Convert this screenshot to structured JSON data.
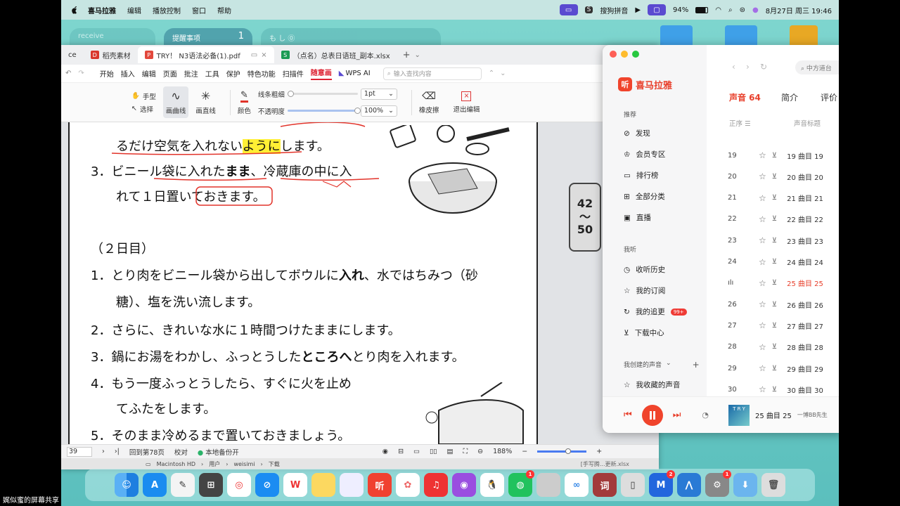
{
  "menubar": {
    "app": "喜马拉雅",
    "items": [
      "编辑",
      "播放控制",
      "窗口",
      "帮助"
    ],
    "pinyin": "搜狗拼音",
    "battery": "94%",
    "datetime": "8月27日 周三  19:46"
  },
  "widgets": {
    "receive": "receive",
    "reminder": "提醒事项",
    "reminder_count": "1",
    "note": "も し ⓪"
  },
  "wps": {
    "tabs": [
      {
        "label": "ce",
        "active": false
      },
      {
        "label": "稻壳素材",
        "active": false,
        "badge": "D",
        "color": "#d9372c"
      },
      {
        "label": "TRY！ N3语法必备(1).pdf",
        "active": true,
        "badge": "P",
        "color": "#e2483c"
      },
      {
        "label": "（点名）总表日语班_副本.xlsx",
        "active": false,
        "badge": "S",
        "color": "#1c9b54"
      }
    ],
    "menus": [
      "开始",
      "插入",
      "编辑",
      "页面",
      "批注",
      "工具",
      "保护",
      "特色功能",
      "扫描件",
      "随意画",
      "WPS AI"
    ],
    "menu_selected": "随意画",
    "search_placeholder": "输入查找内容",
    "toolbar": {
      "hand": "手型",
      "select": "选择",
      "curve": "画曲线",
      "straight": "画直线",
      "color": "颜色",
      "line_width": "线条粗细",
      "line_width_value": "1pt",
      "opacity": "不透明度",
      "opacity_value": "100%",
      "eraser": "橡皮擦",
      "exit": "退出编辑"
    },
    "status": {
      "page_input": "39",
      "goto": "回到第78页",
      "proof": "校对",
      "backup": "本地备份开",
      "zoom": "188%"
    },
    "path": [
      "Macintosh HD",
      "用户",
      "weisimi",
      "下载"
    ],
    "path_file": "[手写腾...更新.xlsx"
  },
  "document": {
    "line1": {
      "pre": "るだけ空気を入れない",
      "highlight": "ように",
      "post": "します。"
    },
    "line2": {
      "num": "3．",
      "a": "ビニール袋に入れた",
      "b": "まま",
      "c": "、冷蔵庫の中に入"
    },
    "line3": "れて１日置いておきます。",
    "heading": "（２日目）",
    "l1": {
      "num": "1．",
      "a": "とり肉をビニール袋から出してボウルに",
      "b": "入れ",
      "c": "、水ではちみつ（砂"
    },
    "l1b": "糖）、塩を洗い流します。",
    "l2": {
      "num": "2．",
      "text": "さらに、きれいな水に１時間つけたままにします。"
    },
    "l3": {
      "num": "3．",
      "a": "鍋にお湯をわかし、ふっとうした",
      "b": "ところへ",
      "c": "とり肉を入れます。"
    },
    "l4": {
      "num": "4．",
      "text": "もう一度ふっとうしたら、すぐに火を止め"
    },
    "l4b": "てふたをします。",
    "l5": {
      "num": "5．",
      "text": "そのまま冷めるまで置いておきましょう。"
    },
    "side": [
      "42",
      "〜",
      "50"
    ]
  },
  "music": {
    "brand": "喜马拉雅",
    "section_recommend": "推荐",
    "nav": [
      "发现",
      "会员专区",
      "排行榜",
      "全部分类",
      "直播"
    ],
    "section_mine": "我听",
    "nav2": [
      "收听历史",
      "我的订阅",
      "我的追更",
      "下载中心"
    ],
    "badge": "99+",
    "created": "我创建的声音",
    "fav": "我收藏的声音",
    "tabs": {
      "sounds": "声音 64",
      "intro": "简介",
      "review": "评价"
    },
    "sort": "正序 ☰",
    "col_title": "声音标题",
    "search": "中方道台",
    "rows": [
      {
        "n": "19",
        "t": "19 曲目 19"
      },
      {
        "n": "20",
        "t": "20 曲目 20"
      },
      {
        "n": "21",
        "t": "21 曲目 21"
      },
      {
        "n": "22",
        "t": "22 曲目 22"
      },
      {
        "n": "23",
        "t": "23 曲目 23"
      },
      {
        "n": "24",
        "t": "24 曲目 24"
      },
      {
        "n": "",
        "t": "25 曲目 25"
      },
      {
        "n": "26",
        "t": "26 曲目 26"
      },
      {
        "n": "27",
        "t": "27 曲目 27"
      },
      {
        "n": "28",
        "t": "28 曲目 28"
      },
      {
        "n": "29",
        "t": "29 曲目 29"
      },
      {
        "n": "30",
        "t": "30 曲目 30"
      }
    ],
    "current_index": 6,
    "now_playing": "25 曲目 25",
    "now_sub": "一博BB先生",
    "cover_text": "T R Y"
  },
  "dock_badges": {
    "wechat": "1",
    "netease": "2",
    "settings": "1"
  },
  "dock_dict": "词",
  "screenshare": "娓似蜜的屏幕共享"
}
